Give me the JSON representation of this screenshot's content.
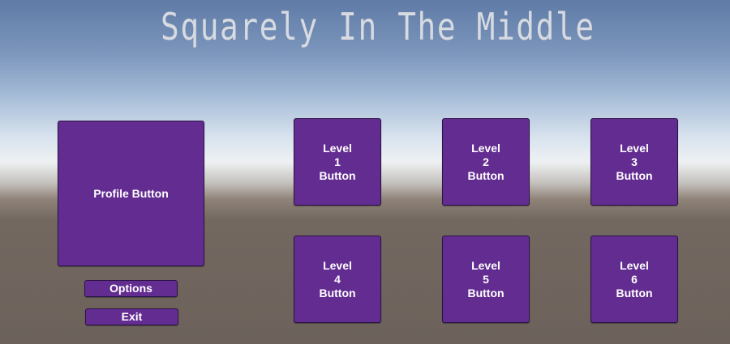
{
  "title": "Squarely In The Middle",
  "menu": {
    "profile_label": "Profile Button",
    "options_label": "Options",
    "exit_label": "Exit"
  },
  "levels": [
    {
      "line1": "Level",
      "num": "1",
      "line3": "Button"
    },
    {
      "line1": "Level",
      "num": "2",
      "line3": "Button"
    },
    {
      "line1": "Level",
      "num": "3",
      "line3": "Button"
    },
    {
      "line1": "Level",
      "num": "4",
      "line3": "Button"
    },
    {
      "line1": "Level",
      "num": "5",
      "line3": "Button"
    },
    {
      "line1": "Level",
      "num": "6",
      "line3": "Button"
    }
  ],
  "colors": {
    "button": "#632c91",
    "button_border": "#2c1346",
    "title": "#d7dbe1"
  }
}
